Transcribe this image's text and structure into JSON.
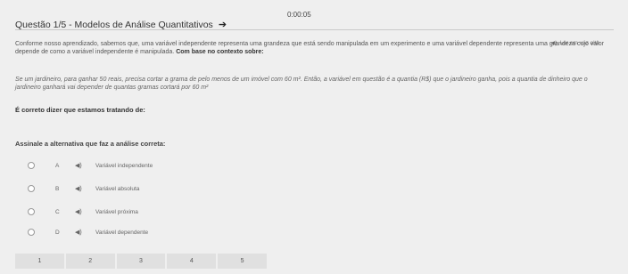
{
  "header": {
    "timer": "0:00:05",
    "title": "Questão 1/5 - Modelos de Análise Quantitativos",
    "arrow_icon": "arrow-right-icon"
  },
  "read_aloud": {
    "label": "Ler em voz alta",
    "icon": "speaker-icon"
  },
  "content": {
    "p1_text": "Conforme nosso aprendizado, sabemos que, uma variável independente representa uma grandeza que está sendo manipulada em um experimento e uma variável dependente representa uma grandeza cujo valor depende de como a variável independente é manipulada. ",
    "p1_bold": "Com base no contexto sobre:",
    "p2": "Se um jardineiro, para ganhar 50 reais, precisa cortar a grama de pelo menos de um imóvel com 60 m². Então, a variável em questão é a quantia (R$) que o jardineiro ganha, pois a quantia de dinheiro que o jardineiro ganhará vai depender de quantas gramas cortará por 60 m²",
    "p3": "É correto dizer que estamos tratando de:",
    "prompt": "Assinale a alternativa que faz a análise correta:"
  },
  "options": [
    {
      "letter": "A",
      "text": "Variável independente"
    },
    {
      "letter": "B",
      "text": "Variável absoluta"
    },
    {
      "letter": "C",
      "text": "Variável próxima"
    },
    {
      "letter": "D",
      "text": "Variável dependente"
    }
  ],
  "pager": [
    "1",
    "2",
    "3",
    "4",
    "5"
  ]
}
